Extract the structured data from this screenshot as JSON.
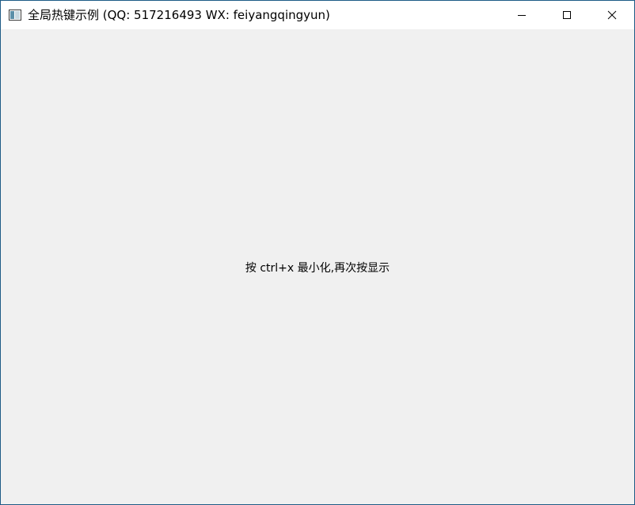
{
  "window": {
    "title": "全局热键示例 (QQ: 517216493 WX: feiyangqingyun)",
    "icon": "app-window-icon",
    "controls": {
      "minimize": "minimize-icon",
      "maximize": "maximize-icon",
      "close": "close-icon"
    }
  },
  "content": {
    "hint_text": "按 ctrl+x 最小化,再次按显示"
  },
  "colors": {
    "background": "#f0f0f0",
    "titlebar": "#ffffff",
    "border": "#1d5b86"
  }
}
